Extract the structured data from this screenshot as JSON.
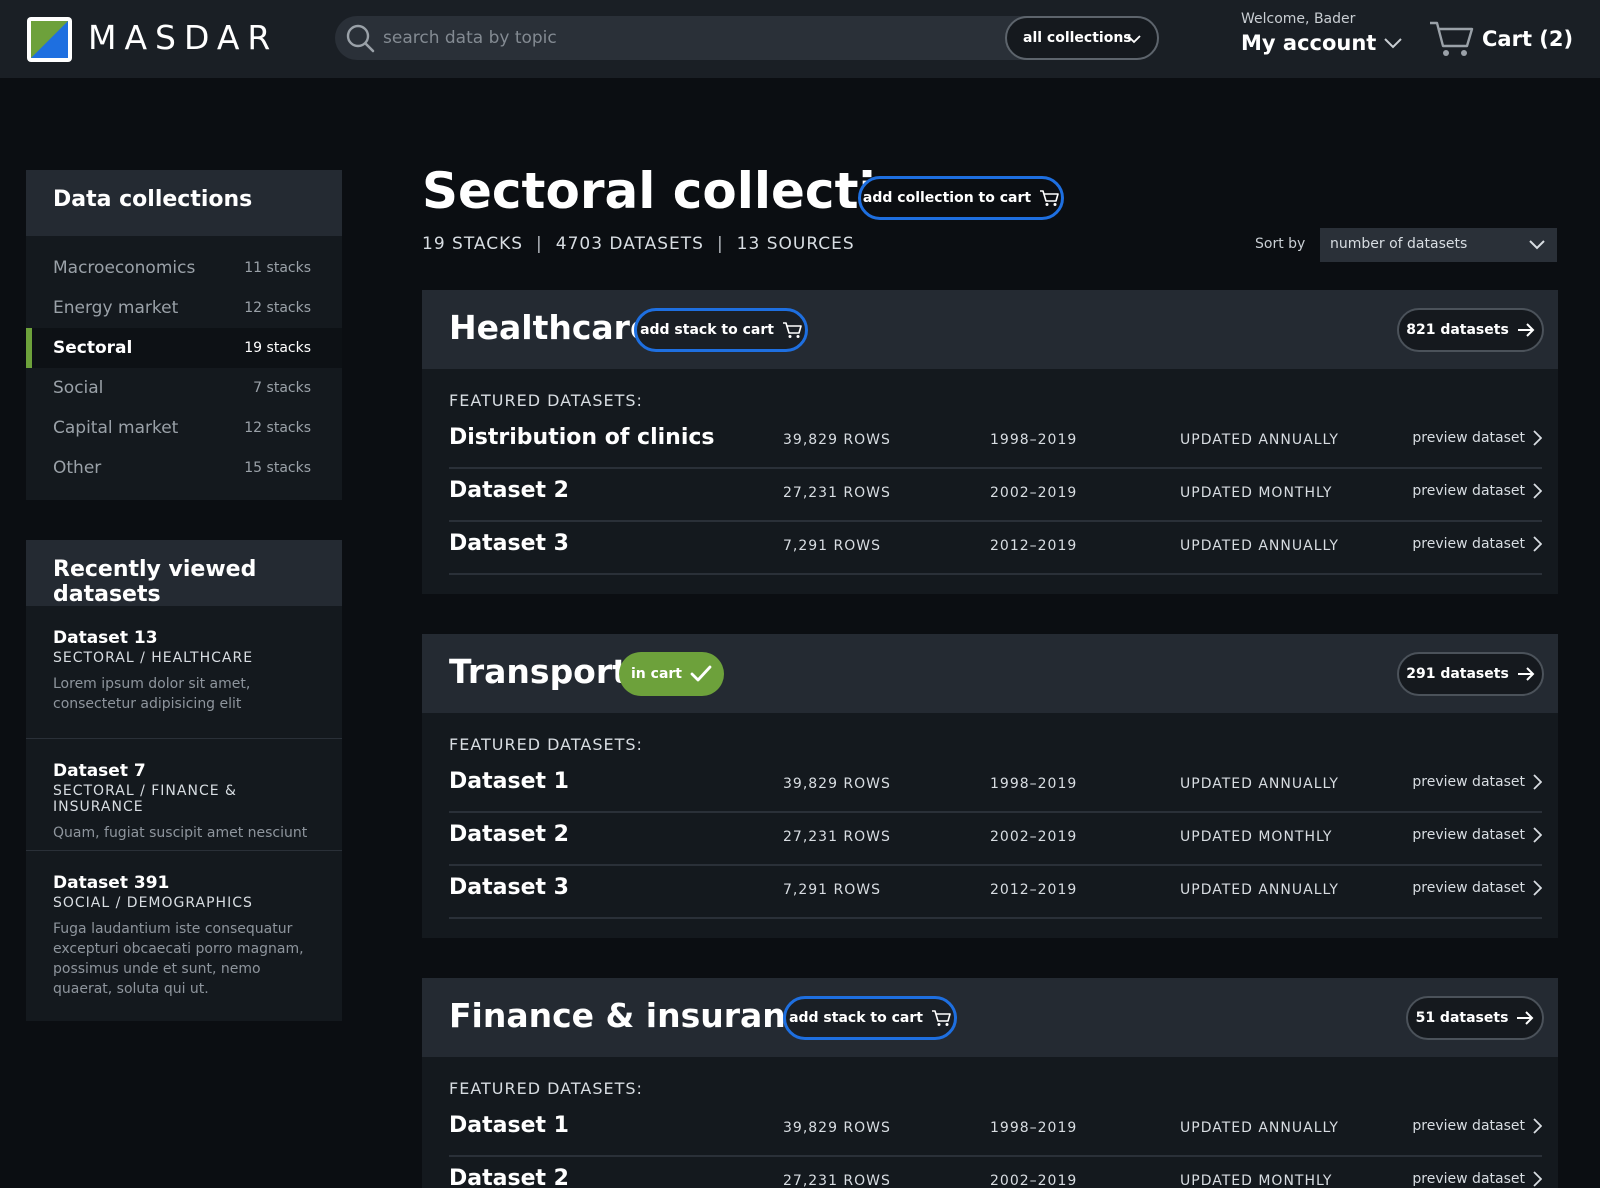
{
  "header": {
    "logo_text": "MASDAR",
    "search_placeholder": "search data by topic",
    "collections_filter": "all collections",
    "welcome": "Welcome, Bader",
    "account_label": "My account",
    "cart_label": "Cart (2)"
  },
  "colors": {
    "accent_blue": "#1e6fe0",
    "accent_green": "#6da13b",
    "background": "#0b0e12",
    "panel": "#14191e",
    "panel_header": "#242a32"
  },
  "sidebar": {
    "collections_title": "Data collections",
    "collections": [
      {
        "label": "Macroeconomics",
        "count": "11 stacks"
      },
      {
        "label": "Energy market",
        "count": "12 stacks"
      },
      {
        "label": "Sectoral",
        "count": "19 stacks",
        "active": true
      },
      {
        "label": "Social",
        "count": "7 stacks"
      },
      {
        "label": "Capital market",
        "count": "12 stacks"
      },
      {
        "label": "Other",
        "count": "15 stacks"
      }
    ],
    "recent_title": "Recently viewed datasets",
    "recent": [
      {
        "title": "Dataset 13",
        "path": "SECTORAL / HEALTHCARE",
        "desc": "Lorem ipsum dolor sit amet, consectetur adipisicing elit"
      },
      {
        "title": "Dataset 7",
        "path": "SECTORAL / FINANCE & INSURANCE",
        "desc": "Quam, fugiat suscipit amet nesciunt"
      },
      {
        "title": "Dataset 391",
        "path": "SOCIAL / DEMOGRAPHICS",
        "desc": "Fuga laudantium iste consequatur excepturi obcaecati porro magnam, possimus unde et sunt, nemo quaerat, soluta qui ut."
      }
    ]
  },
  "main": {
    "title": "Sectoral collection",
    "add_collection_label": "add collection to cart",
    "stats": {
      "stacks": "19 STACKS",
      "datasets": "4703 DATASETS",
      "sources": "13 SOURCES"
    },
    "sort_label": "Sort by",
    "sort_value": "number of datasets",
    "featured_label": "FEATURED DATASETS:",
    "preview_label": "preview dataset",
    "stacks": [
      {
        "title": "Healthcare",
        "cart_label": "add stack to cart",
        "datasets_label": "821 datasets",
        "datasets": [
          {
            "name": "Distribution of clinics",
            "rows": "39,829 ROWS",
            "years": "1998–2019",
            "update": "UPDATED ANNUALLY"
          },
          {
            "name": "Dataset 2",
            "rows": "27,231 ROWS",
            "years": "2002–2019",
            "update": "UPDATED MONTHLY"
          },
          {
            "name": "Dataset 3",
            "rows": "7,291 ROWS",
            "years": "2012–2019",
            "update": "UPDATED ANNUALLY"
          }
        ]
      },
      {
        "title": "Transport",
        "cart_label": "in cart",
        "datasets_label": "291 datasets",
        "datasets": [
          {
            "name": "Dataset 1",
            "rows": "39,829 ROWS",
            "years": "1998–2019",
            "update": "UPDATED ANNUALLY"
          },
          {
            "name": "Dataset 2",
            "rows": "27,231 ROWS",
            "years": "2002–2019",
            "update": "UPDATED MONTHLY"
          },
          {
            "name": "Dataset 3",
            "rows": "7,291 ROWS",
            "years": "2012–2019",
            "update": "UPDATED ANNUALLY"
          }
        ]
      },
      {
        "title": "Finance & insurance",
        "cart_label": "add stack to cart",
        "datasets_label": "51 datasets",
        "datasets": [
          {
            "name": "Dataset 1",
            "rows": "39,829 ROWS",
            "years": "1998–2019",
            "update": "UPDATED ANNUALLY"
          },
          {
            "name": "Dataset 2",
            "rows": "27,231 ROWS",
            "years": "2002–2019",
            "update": "UPDATED MONTHLY"
          }
        ]
      }
    ]
  }
}
